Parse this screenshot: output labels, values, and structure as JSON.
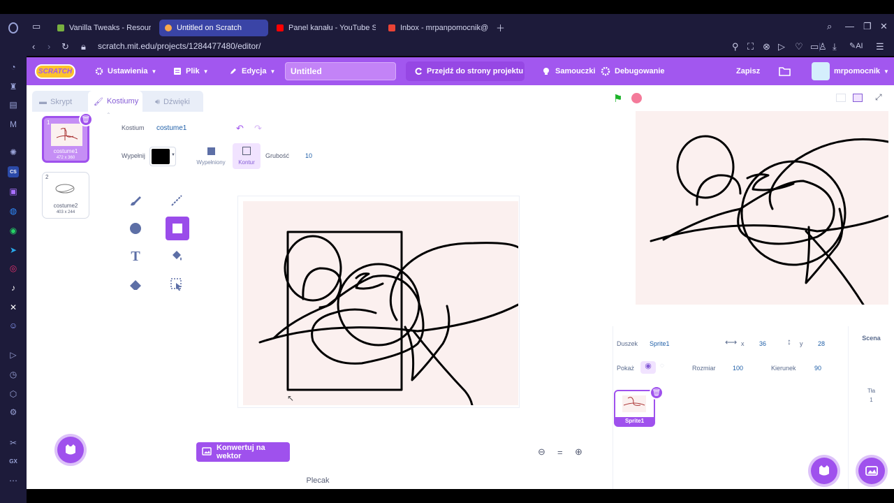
{
  "browser": {
    "tabs": [
      {
        "label": "Vanilla Tweaks - Resource",
        "active": false
      },
      {
        "label": "Untitled on Scratch",
        "active": true
      },
      {
        "label": "Panel kanału - YouTube St",
        "active": false
      },
      {
        "label": "Inbox - mrpanpomocnik@",
        "active": false
      }
    ],
    "url": "scratch.mit.edu/projects/1284477480/editor/",
    "ai_label": "AI",
    "sidebar_labels": {
      "cs": "CS",
      "gx": "GX"
    }
  },
  "menu": {
    "logo": "SCRATCH",
    "settings": "Ustawienia",
    "file": "Plik",
    "edit": "Edycja",
    "project_title": "Untitled",
    "project_page": "Przejdź do strony projektu",
    "tutorials": "Samouczki",
    "debugging": "Debugowanie",
    "save": "Zapisz",
    "username": "mrpomocnik"
  },
  "editor": {
    "tabs": {
      "code": "Skrypt",
      "costumes": "Kostiumy",
      "sounds": "Dźwięki"
    },
    "costumes": [
      {
        "num": "1",
        "name": "costume1",
        "size": "472 x 360",
        "selected": true
      },
      {
        "num": "2",
        "name": "costume2",
        "size": "403 x 244",
        "selected": false
      }
    ],
    "costume_label": "Kostium",
    "costume_name": "costume1",
    "fill_label": "Wypełnij",
    "fill_color": "#000000",
    "filled_label": "Wypełniony",
    "outline_label": "Kontur",
    "thickness_label": "Grubość",
    "thickness_value": "10",
    "convert_button": "Konwertuj na wektor",
    "zoom_reset": "=",
    "backpack": "Plecak"
  },
  "sprite": {
    "sprite_label": "Duszek",
    "sprite_name": "Sprite1",
    "x_label": "x",
    "x_value": "36",
    "y_label": "y",
    "y_value": "28",
    "show_label": "Pokaż",
    "size_label": "Rozmiar",
    "size_value": "100",
    "direction_label": "Kierunek",
    "direction_value": "90",
    "sprite_tile_name": "Sprite1"
  },
  "scene": {
    "title": "Scena",
    "backdrops_label": "Tła",
    "backdrops_count": "1"
  }
}
